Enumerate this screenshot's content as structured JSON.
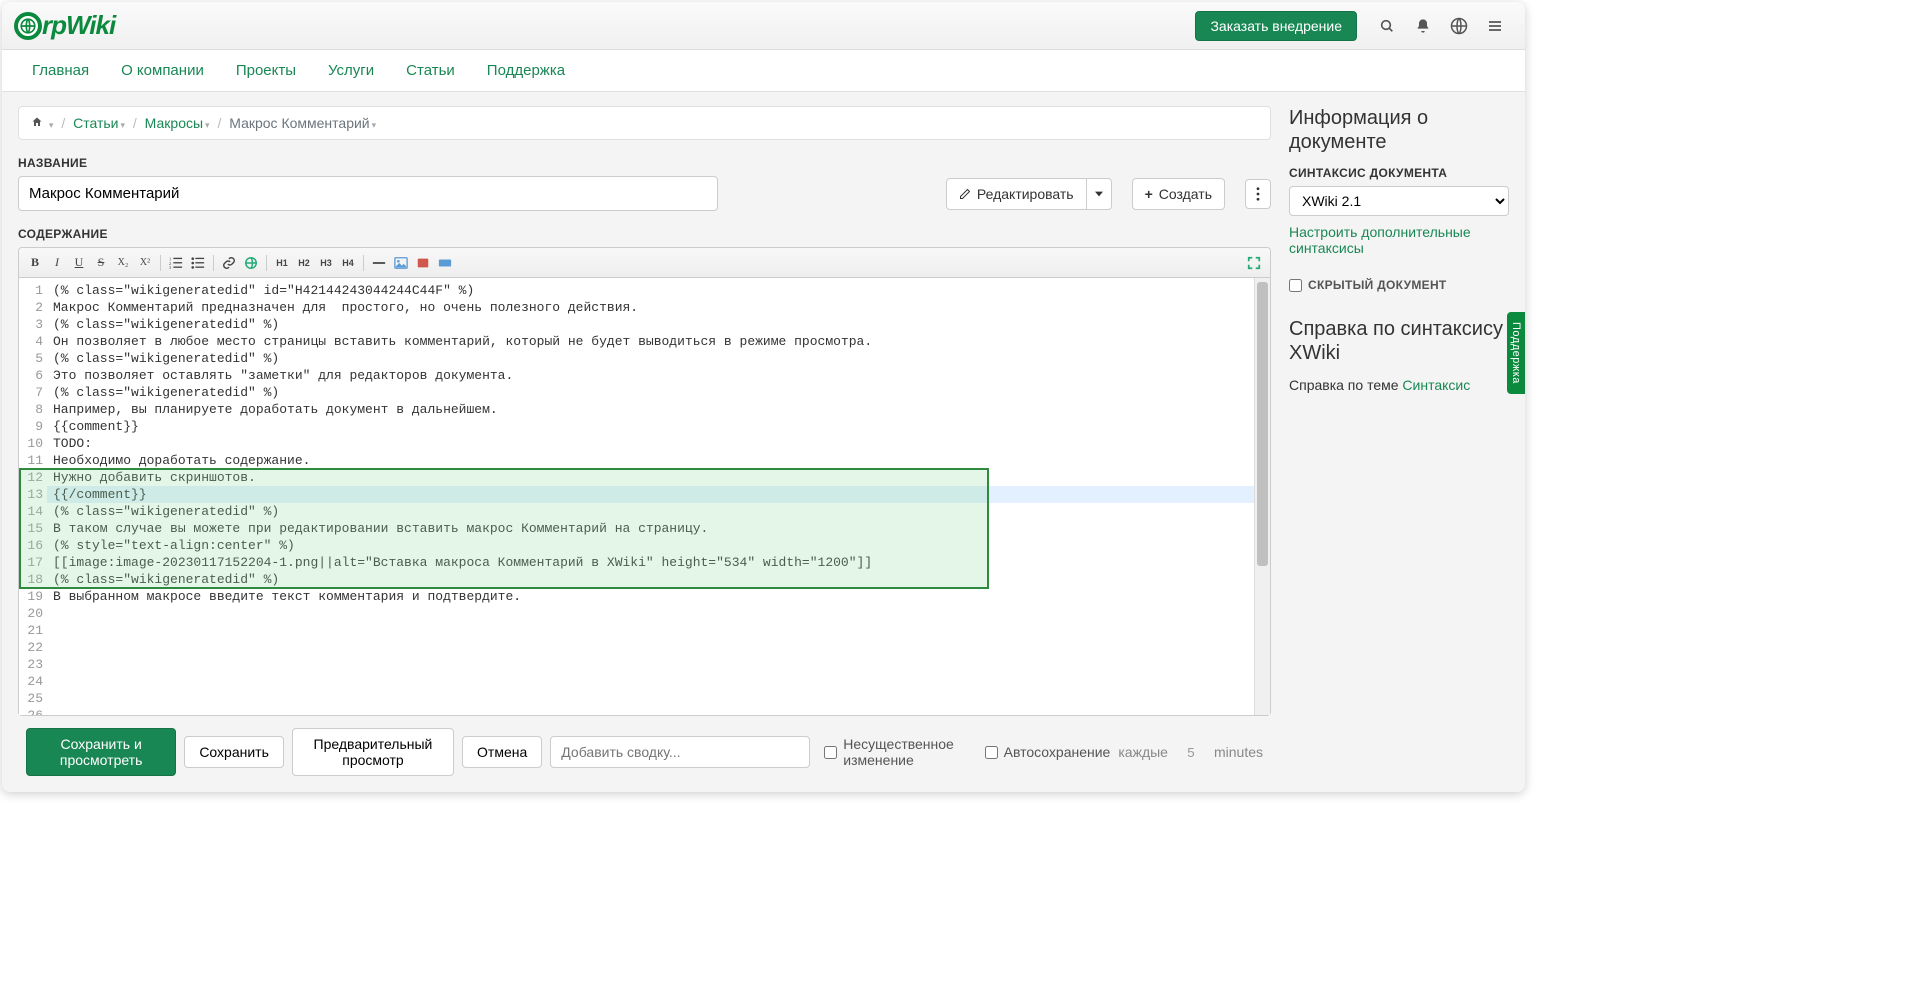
{
  "banner": {
    "logo_text": "rpWiki",
    "cta": "Заказать внедрение"
  },
  "nav": {
    "items": [
      "Главная",
      "О компании",
      "Проекты",
      "Услуги",
      "Статьи",
      "Поддержка"
    ]
  },
  "breadcrumb": {
    "items": [
      {
        "label": "Статьи",
        "link": true
      },
      {
        "label": "Макросы",
        "link": true
      },
      {
        "label": "Макрос Комментарий",
        "link": false
      }
    ]
  },
  "title": {
    "label": "НАЗВАНИЕ",
    "value": "Макрос Комментарий",
    "edit": "Редактировать",
    "create": "Создать"
  },
  "content_label": "СОДЕРЖАНИЕ",
  "code": {
    "lines": [
      "(% class=\"wikigeneratedid\" id=\"H42144243044244C44F\" %)",
      "Макрос Комментарий предназначен для  простого, но очень полезного действия.",
      "",
      "(% class=\"wikigeneratedid\" %)",
      "Он позволяет в любое место страницы вставить комментарий, который не будет выводиться в режиме просмотра.",
      "",
      "(% class=\"wikigeneratedid\" %)",
      "Это позволяет оставлять \"заметки\" для редакторов документа.",
      "",
      "(% class=\"wikigeneratedid\" %)",
      "Например, вы планируете доработать документ в дальнейшем.",
      "",
      "{{comment}}",
      "TODO:",
      "Необходимо доработать содержание.",
      "Нужно добавить скриншотов.",
      "{{/comment}}",
      "",
      "(% class=\"wikigeneratedid\" %)",
      "В таком случае вы можете при редактировании вставить макрос Комментарий на страницу.",
      "",
      "(% style=\"text-align:center\" %)",
      "[[image:image-20230117152204-1.png||alt=\"Вставка макроса Комментарий в XWiki\" height=\"534\" width=\"1200\"]]",
      "",
      "(% class=\"wikigeneratedid\" %)",
      "В выбранном макросе введите текст комментария и подтвердите."
    ],
    "highlight_start": 12,
    "highlight_end": 18,
    "active_line": 17
  },
  "footer": {
    "save_view": "Сохранить и просмотреть",
    "save": "Сохранить",
    "preview": "Предварительный просмотр",
    "cancel": "Отмена",
    "summary_placeholder": "Добавить сводку...",
    "minor": "Несущественное изменение",
    "autosave": "Автосохранение",
    "autosave_every": "каждые",
    "autosave_minutes_value": "5",
    "autosave_unit": "minutes"
  },
  "right": {
    "doc_info_title": "Информация о документе",
    "syntax_label": "СИНТАКСИС ДОКУМЕНТА",
    "syntax_value": "XWiki 2.1",
    "configure_link": "Настроить дополнительные синтаксисы",
    "hidden_label": "СКРЫТЫЙ ДОКУМЕНТ",
    "help_title": "Справка по синтаксису XWiki",
    "help_prefix": "Справка по теме ",
    "help_link": "Синтаксис"
  },
  "support_tab": "Поддержка"
}
